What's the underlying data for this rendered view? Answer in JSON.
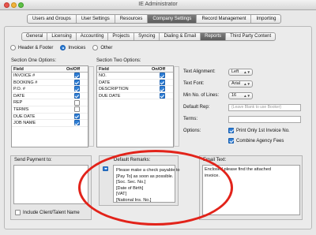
{
  "window": {
    "title": "IE Administrator"
  },
  "main_tabs": [
    {
      "label": "Users and Groups",
      "active": false
    },
    {
      "label": "User Settings",
      "active": false
    },
    {
      "label": "Resources",
      "active": false
    },
    {
      "label": "Company Settings",
      "active": true
    },
    {
      "label": "Record Management",
      "active": false
    },
    {
      "label": "Importing",
      "active": false
    }
  ],
  "sub_tabs": [
    {
      "label": "General",
      "active": false
    },
    {
      "label": "Licensing",
      "active": false
    },
    {
      "label": "Accounting",
      "active": false
    },
    {
      "label": "Projects",
      "active": false
    },
    {
      "label": "Syncing",
      "active": false
    },
    {
      "label": "Dialing & Email",
      "active": false
    },
    {
      "label": "Reports",
      "active": true
    },
    {
      "label": "Third Party Content",
      "active": false
    }
  ],
  "report_type": {
    "options": [
      "Header & Footer",
      "Invoices",
      "Other"
    ],
    "selected": "Invoices"
  },
  "section_one": {
    "label": "Section One Options:",
    "col_field": "Field",
    "col_on": "On/Off",
    "rows": [
      {
        "field": "INVOICE #",
        "on": true
      },
      {
        "field": "BOOKING #",
        "on": true
      },
      {
        "field": "P.O. #",
        "on": true
      },
      {
        "field": "DATE",
        "on": true
      },
      {
        "field": "REP",
        "on": false
      },
      {
        "field": "TERMS",
        "on": false
      },
      {
        "field": "DUE DATE",
        "on": true
      },
      {
        "field": "JOB NAME",
        "on": true
      }
    ]
  },
  "section_two": {
    "label": "Section Two Options:",
    "col_field": "Field",
    "col_on": "On/Off",
    "rows": [
      {
        "field": "NO.",
        "on": true
      },
      {
        "field": "DATE",
        "on": true
      },
      {
        "field": "DESCRIPTION",
        "on": true
      },
      {
        "field": "DUE DATE",
        "on": true
      }
    ]
  },
  "settings": {
    "text_alignment": {
      "label": "Text Alignment:",
      "value": "Left"
    },
    "text_font": {
      "label": "Text Font:",
      "value": "Arial"
    },
    "min_lines": {
      "label": "Min No. of Lines:",
      "value": "16"
    },
    "default_rep": {
      "label": "Default Rep:",
      "placeholder": "(Leave Blank to use Booker)"
    },
    "terms": {
      "label": "Terms:",
      "value": ""
    },
    "options_label": "Options:",
    "options": [
      {
        "label": "Print Only 1st Invoice No.",
        "on": true
      },
      {
        "label": "Combine Agency Fees",
        "on": true
      }
    ]
  },
  "send_payment": {
    "title": "Send Payment to:",
    "include_label": "Include Client/Talent Name",
    "include_on": false
  },
  "default_remarks": {
    "title": "Default Remarks:",
    "lines": [
      "Please make a check payable to",
      "[Pay To] as soon as possible.",
      "[Soc. Sec. No.]",
      "[Date of Birth]",
      "[VAT]",
      "[National Ins. No.]"
    ]
  },
  "email_text": {
    "title": "Email Text:",
    "lines": [
      "Enclosed please find the attached",
      "invoice."
    ]
  },
  "colors": {
    "accent": "#2f7fd6",
    "annotation": "#e2231a"
  }
}
